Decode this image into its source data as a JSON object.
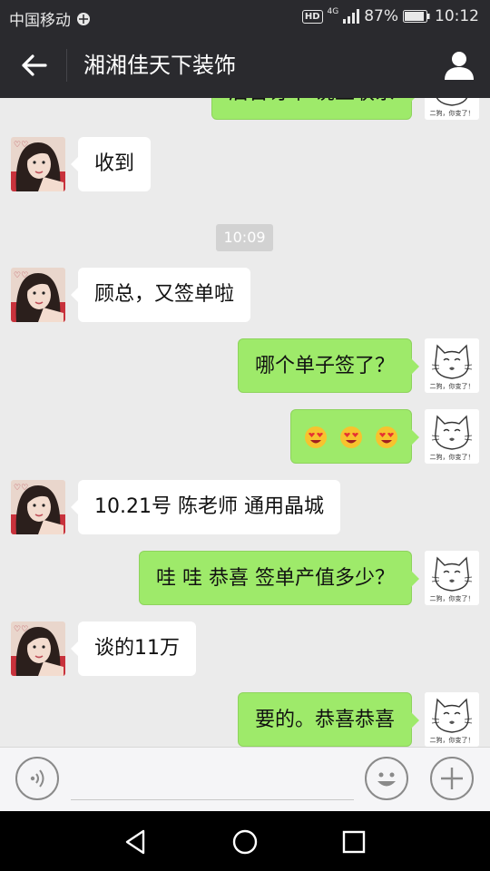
{
  "status": {
    "carrier": "中国移动",
    "hd": "HD",
    "network": "4G",
    "battery": "87%",
    "time": "10:12"
  },
  "header": {
    "title": "湘湘佳天下装饰"
  },
  "messages": [
    {
      "side": "out",
      "text": "后台订单 说上联系",
      "partial": true
    },
    {
      "side": "in",
      "text": "收到"
    },
    {
      "type": "time",
      "text": "10:09"
    },
    {
      "side": "in",
      "text": "顾总，又签单啦"
    },
    {
      "side": "out",
      "text": "哪个单子签了？"
    },
    {
      "side": "out",
      "emoji": "heart-eyes-emoji",
      "count": 3
    },
    {
      "side": "in",
      "text": "10.21号  陈老师 通用晶城"
    },
    {
      "side": "out",
      "text": "哇  哇  恭喜      签单产值多少？"
    },
    {
      "side": "in",
      "text": "谈的11万"
    },
    {
      "side": "out",
      "text": "要的。恭喜恭喜"
    }
  ],
  "avatar_out_caption": "二狗，你变了！",
  "input": {
    "value": "",
    "placeholder": ""
  },
  "colors": {
    "bar": "#2a2a2e",
    "chat_bg": "#ebebeb",
    "out_bubble": "#9eea6a",
    "in_bubble": "#ffffff"
  }
}
